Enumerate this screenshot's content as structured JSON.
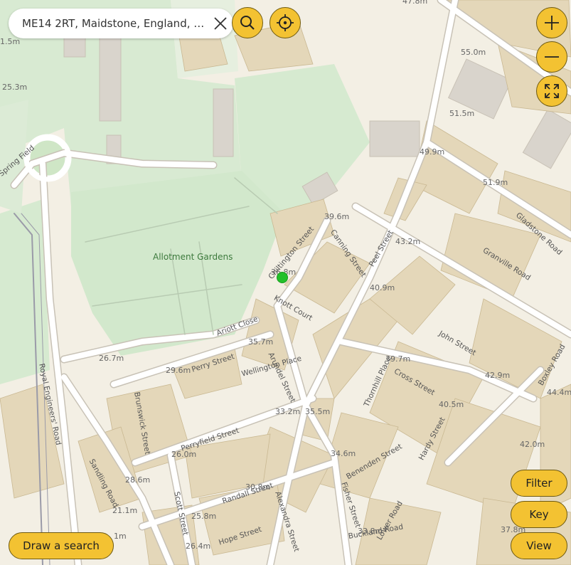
{
  "search": {
    "value": "ME14 2RT, Maidstone, England, G..."
  },
  "icons": {
    "clear": "close-icon",
    "search": "search-icon",
    "locate": "crosshair-icon",
    "zoom_in": "plus-icon",
    "zoom_out": "minus-icon",
    "fullscreen": "expand-icon"
  },
  "buttons": {
    "filter": "Filter",
    "key": "Key",
    "view": "View",
    "draw_search": "Draw a search"
  },
  "colors": {
    "accent": "#f3c232",
    "location_dot": "#22c02a",
    "map_background": "#f3efe4",
    "green_space": "#d6ead0",
    "building": "#e0d3b5"
  },
  "map": {
    "area_labels": [
      "Allotment Gardens"
    ],
    "street_labels": [
      "Spring Field",
      "Royal Engineers' Road",
      "Ariott Close",
      "Perry Street",
      "Wellington Place",
      "Arundel Street",
      "Chiltington Street",
      "Knott Court",
      "Canning Street",
      "Peel Street",
      "John Street",
      "Cross Street",
      "Thornhill Place",
      "Granville Road",
      "Gladstone Road",
      "Boxley Road",
      "Perryfield Street",
      "Sandling Road",
      "Scott Street",
      "Randall Street",
      "Alexandra Street",
      "Hope Street",
      "Fisher Street",
      "Benenden Street",
      "Hardy Street",
      "Lower Road",
      "Brunswick Street",
      "Buckland Road"
    ],
    "elevation_labels": [
      "47.8m",
      "55.0m",
      "25.3m",
      "51.5m",
      "49.9m",
      "51.9m",
      "39.6m",
      "43.2m",
      "36.8m",
      "40.9m",
      "35.7m",
      "26.7m",
      "29.6m",
      "39.7m",
      "42.9m",
      "44.4m",
      "33.2m",
      "35.5m",
      "40.5m",
      "42.0m",
      "26.0m",
      "34.6m",
      "28.6m",
      "21.1m",
      "30.8m",
      "25.8m",
      "37.8m",
      "26.4m",
      "33.8m",
      "1m",
      "1.5m"
    ]
  }
}
